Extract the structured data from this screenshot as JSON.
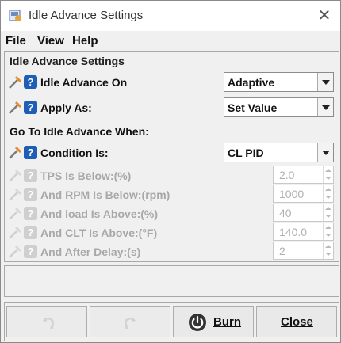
{
  "window": {
    "title": "Idle Advance Settings",
    "close_glyph": "✕"
  },
  "menu": {
    "file": "File",
    "view": "View",
    "help": "Help"
  },
  "panel": {
    "title": "Idle Advance Settings"
  },
  "fields": {
    "idle_advance_on": {
      "label": "Idle Advance On",
      "value": "Adaptive"
    },
    "apply_as": {
      "label": "Apply As:",
      "value": "Set Value"
    },
    "section": "Go To Idle Advance When:",
    "condition": {
      "label": "Condition Is:",
      "value": "CL PID"
    },
    "tps": {
      "label": "TPS Is Below:(%)",
      "value": "2.0"
    },
    "rpm": {
      "label": "And RPM Is Below:(rpm)",
      "value": "1000"
    },
    "load": {
      "label": "And load Is Above:(%)",
      "value": "40"
    },
    "clt": {
      "label": "And CLT Is Above:(°F)",
      "value": "140.0"
    },
    "delay": {
      "label": "And After Delay:(s)",
      "value": "2"
    }
  },
  "help_glyph": "?",
  "buttons": {
    "burn": "Burn",
    "close": "Close"
  },
  "icons": {
    "app": "app-icon",
    "wand": "wand-icon",
    "help": "help-icon",
    "undo": "undo-icon",
    "redo": "redo-icon",
    "burn": "power-icon"
  },
  "colors": {
    "help_blue": "#1e5fb5",
    "disabled_text": "#a8a8a8"
  }
}
